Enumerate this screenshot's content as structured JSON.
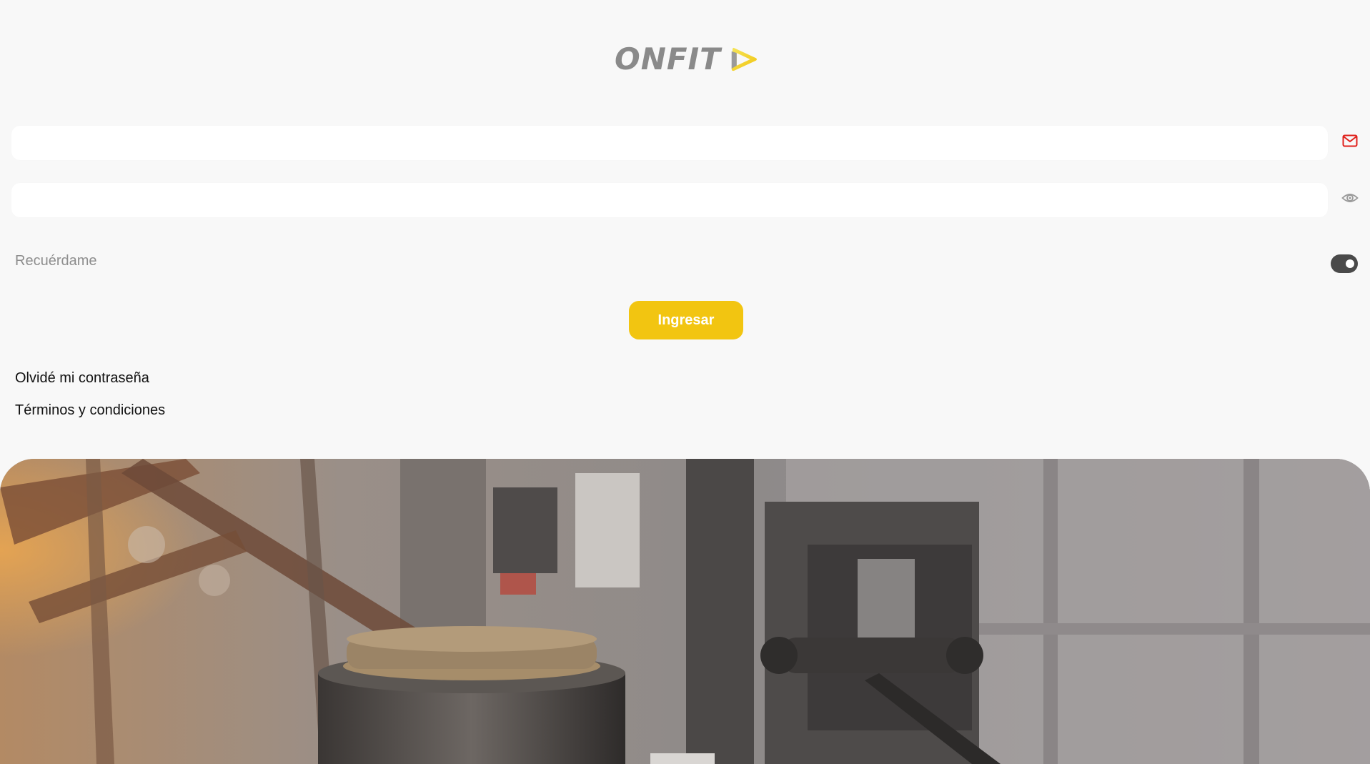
{
  "brand": {
    "name": "ONFIT",
    "accent_color": "#f2c511",
    "logo_gray": "#8a8a8a"
  },
  "form": {
    "email": {
      "value": "",
      "placeholder": "",
      "icon": "envelope-icon",
      "icon_color": "#e0201b"
    },
    "password": {
      "value": "",
      "placeholder": "",
      "icon": "eye-icon"
    },
    "remember_me": {
      "label": "Recuérdame",
      "checked": true
    },
    "submit_label": "Ingresar"
  },
  "links": {
    "forgot_password": "Olvidé mi contraseña",
    "terms": "Términos y condiciones"
  },
  "hero": {
    "image": "gym-equipment-photo"
  }
}
